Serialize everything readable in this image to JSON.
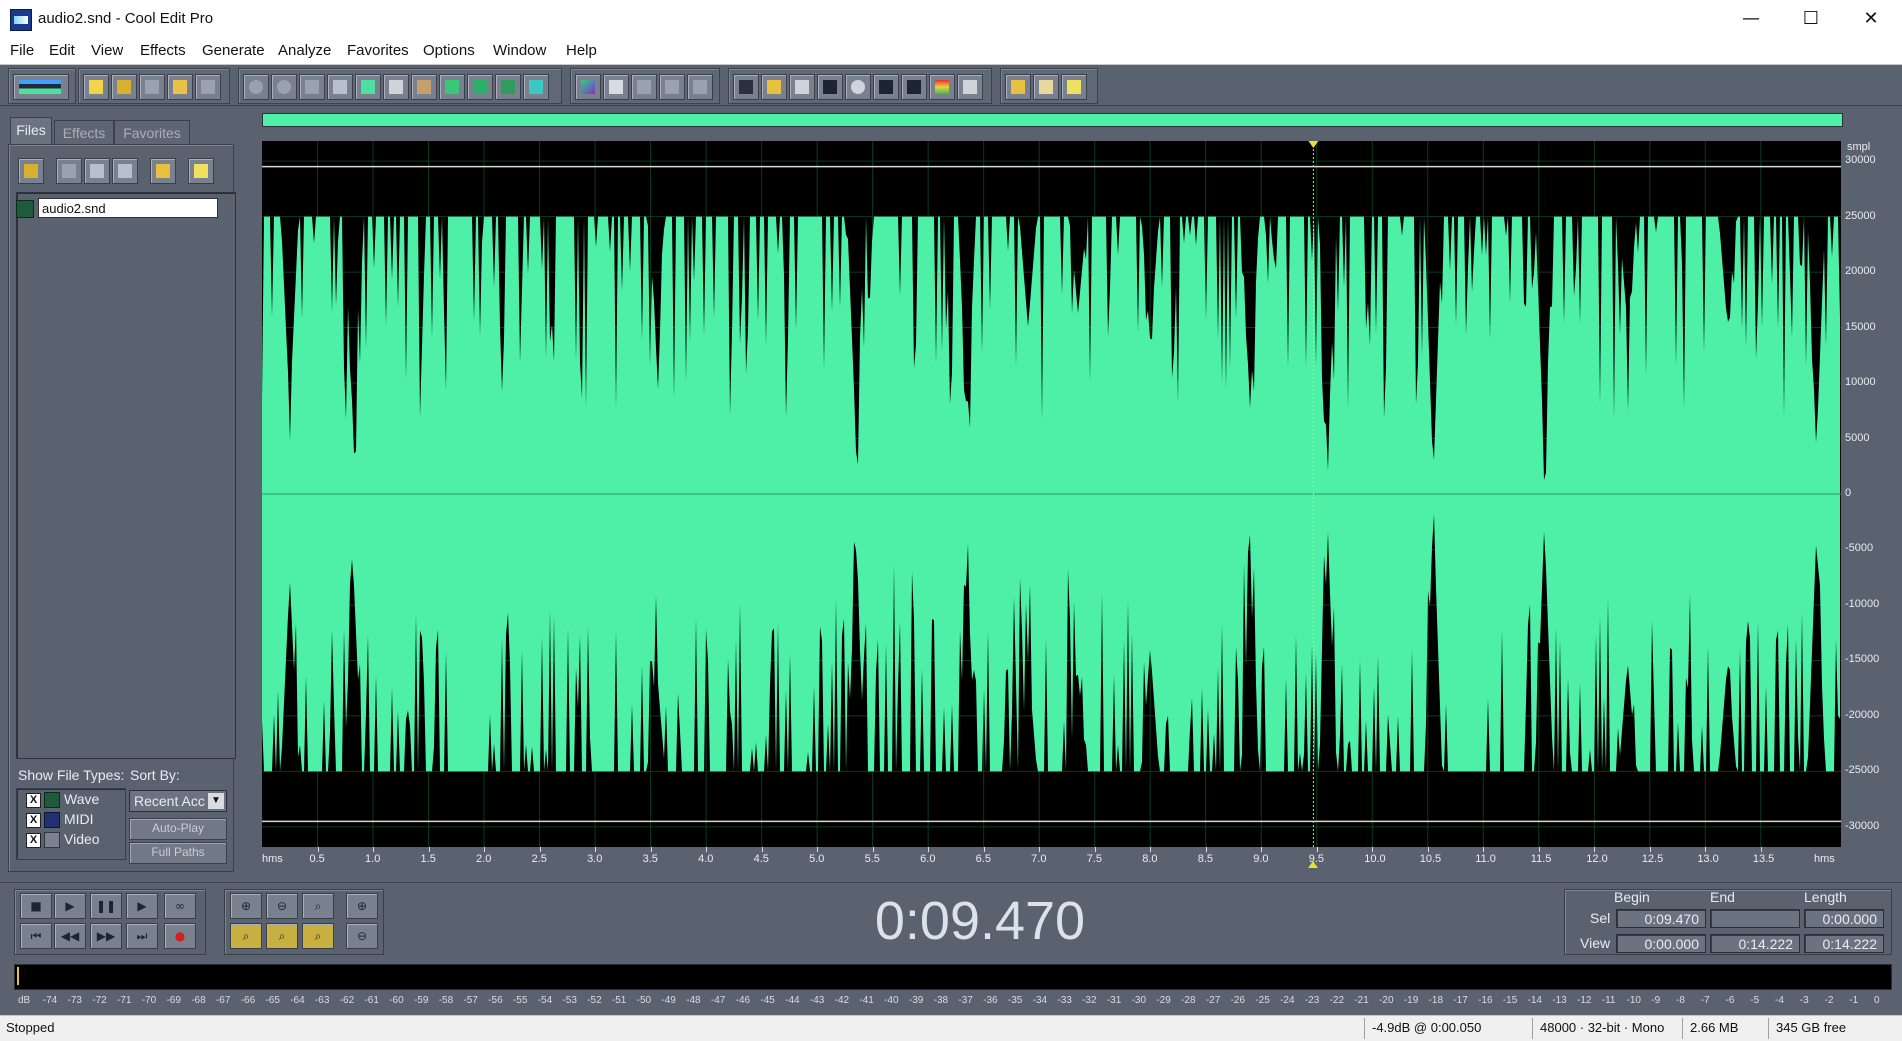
{
  "window": {
    "title": "audio2.snd - Cool Edit Pro",
    "minimize": "—",
    "maximize": "☐",
    "close": "✕"
  },
  "menu": [
    "File",
    "Edit",
    "View",
    "Effects",
    "Generate",
    "Analyze",
    "Favorites",
    "Options",
    "Window",
    "Help"
  ],
  "panel": {
    "tabs": [
      "Files",
      "Effects",
      "Favorites"
    ],
    "active_tab": "Files",
    "files": [
      "audio2.snd"
    ],
    "show_types_label": "Show File Types:",
    "sort_label": "Sort By:",
    "sort_value": "Recent Acc",
    "types": [
      {
        "label": "Wave",
        "checked": "X"
      },
      {
        "label": "MIDI",
        "checked": "X"
      },
      {
        "label": "Video",
        "checked": "X"
      }
    ],
    "auto_play": "Auto-Play",
    "full_paths": "Full Paths"
  },
  "waveform": {
    "units": "smpl",
    "amp_ticks": [
      "30000",
      "25000",
      "20000",
      "15000",
      "10000",
      "5000",
      "0",
      "-5000",
      "-10000",
      "-15000",
      "-20000",
      "-25000",
      "-30000"
    ],
    "time_unit": "hms",
    "time_ticks": [
      "0.5",
      "1.0",
      "1.5",
      "2.0",
      "2.5",
      "3.0",
      "3.5",
      "4.0",
      "4.5",
      "5.0",
      "5.5",
      "6.0",
      "6.5",
      "7.0",
      "7.5",
      "8.0",
      "8.5",
      "9.0",
      "9.5",
      "10.0",
      "10.5",
      "11.0",
      "11.5",
      "12.0",
      "12.5",
      "13.0",
      "13.5"
    ],
    "duration": 14.222,
    "cursor": 9.47,
    "wave_color": "#4ef0a8"
  },
  "transport": {
    "time": "0:09.470",
    "begin_label": "Begin",
    "end_label": "End",
    "length_label": "Length",
    "sel_label": "Sel",
    "view_label": "View",
    "sel_begin": "0:09.470",
    "sel_end": "",
    "sel_length": "0:00.000",
    "view_begin": "0:00.000",
    "view_end": "0:14.222",
    "view_length": "0:14.222"
  },
  "meter": {
    "scale": [
      "dB",
      "-74",
      "-73",
      "-72",
      "-71",
      "-70",
      "-69",
      "-68",
      "-67",
      "-66",
      "-65",
      "-64",
      "-63",
      "-62",
      "-61",
      "-60",
      "-59",
      "-58",
      "-57",
      "-56",
      "-55",
      "-54",
      "-53",
      "-52",
      "-51",
      "-50",
      "-49",
      "-48",
      "-47",
      "-46",
      "-45",
      "-44",
      "-43",
      "-42",
      "-41",
      "-40",
      "-39",
      "-38",
      "-37",
      "-36",
      "-35",
      "-34",
      "-33",
      "-32",
      "-31",
      "-30",
      "-29",
      "-28",
      "-27",
      "-26",
      "-25",
      "-24",
      "-23",
      "-22",
      "-21",
      "-20",
      "-19",
      "-18",
      "-17",
      "-16",
      "-15",
      "-14",
      "-13",
      "-12",
      "-11",
      "-10",
      "-9",
      "-8",
      "-7",
      "-6",
      "-5",
      "-4",
      "-3",
      "-2",
      "-1",
      "0"
    ]
  },
  "status": {
    "state": "Stopped",
    "level": "-4.9dB @  0:00.050",
    "format": "48000 · 32-bit · Mono",
    "size": "2.66 MB",
    "free": "345 GB free"
  }
}
